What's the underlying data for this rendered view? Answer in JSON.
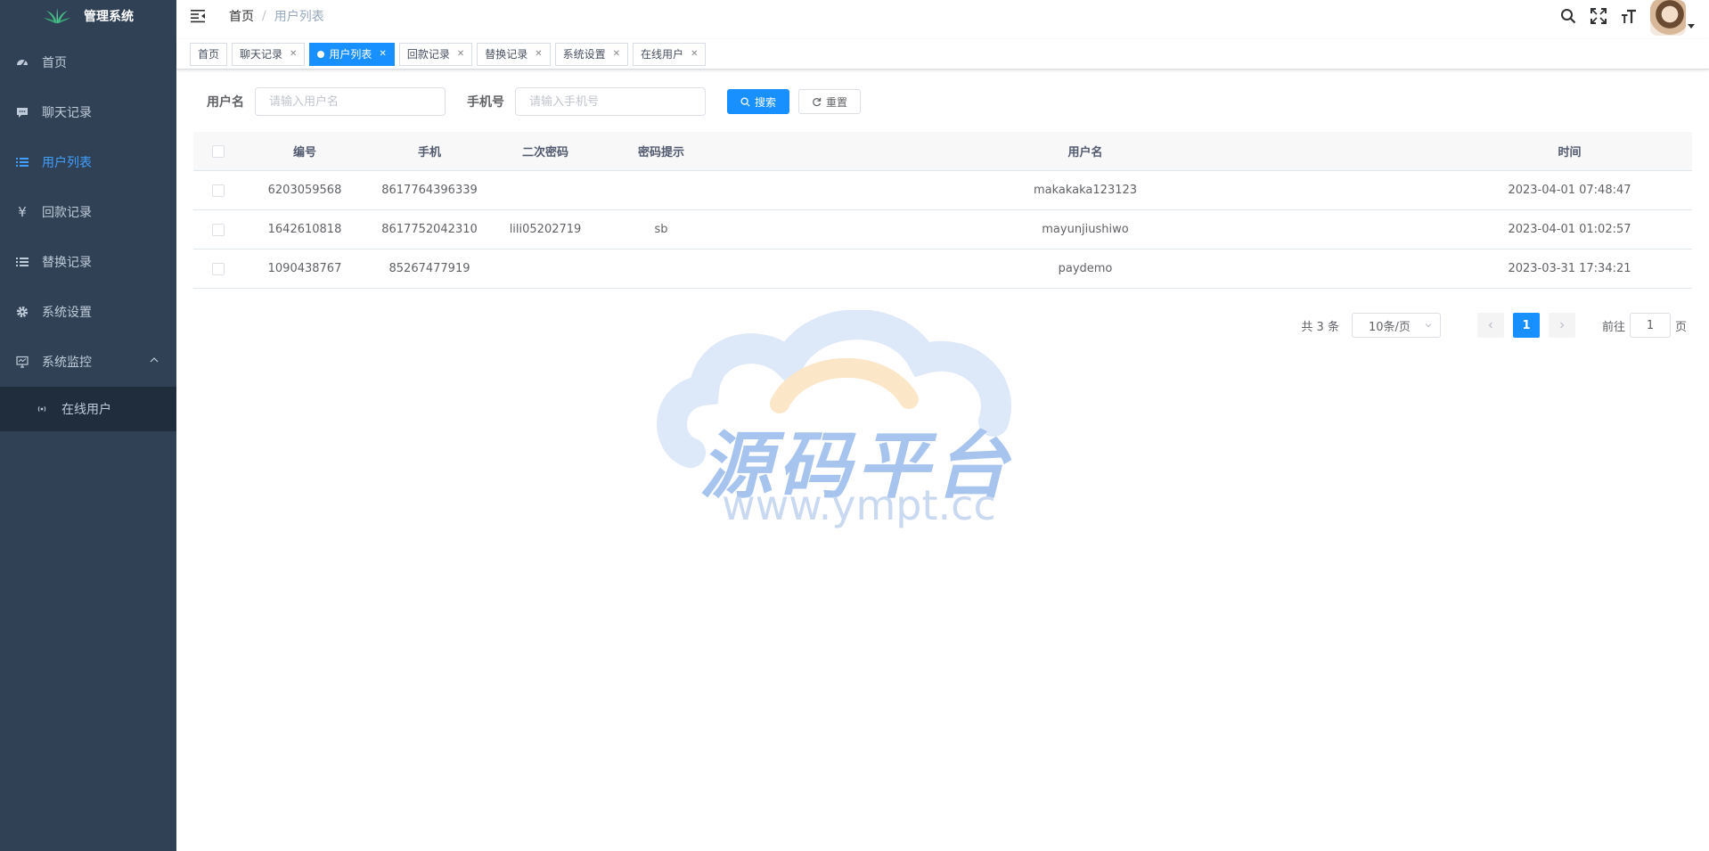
{
  "app": {
    "logo_text": "管理系统"
  },
  "sidebar": {
    "items": [
      {
        "label": "首页",
        "icon": "dashboard-icon"
      },
      {
        "label": "聊天记录",
        "icon": "chat-icon"
      },
      {
        "label": "用户列表",
        "icon": "list-icon",
        "active": true
      },
      {
        "label": "回款记录",
        "icon": "yen-icon"
      },
      {
        "label": "替换记录",
        "icon": "list-icon"
      },
      {
        "label": "系统设置",
        "icon": "gear-icon"
      },
      {
        "label": "系统监控",
        "icon": "monitor-icon",
        "expanded": true
      }
    ],
    "submenu": [
      {
        "label": "在线用户",
        "icon": "online-icon"
      }
    ]
  },
  "breadcrumb": {
    "home": "首页",
    "separator": "/",
    "current": "用户列表"
  },
  "tags": [
    {
      "label": "首页"
    },
    {
      "label": "聊天记录"
    },
    {
      "label": "用户列表",
      "active": true
    },
    {
      "label": "回款记录"
    },
    {
      "label": "替换记录"
    },
    {
      "label": "系统设置"
    },
    {
      "label": "在线用户"
    }
  ],
  "search": {
    "username_label": "用户名",
    "username_placeholder": "请输入用户名",
    "phone_label": "手机号",
    "phone_placeholder": "请输入手机号",
    "search_button": "搜索",
    "reset_button": "重置"
  },
  "table": {
    "columns": [
      "编号",
      "手机",
      "二次密码",
      "密码提示",
      "用户名",
      "时间"
    ],
    "rows": [
      {
        "id": "6203059568",
        "phone": "8617764396339",
        "pwd2": "",
        "hint": "",
        "username": "makakaka123123",
        "time": "2023-04-01 07:48:47"
      },
      {
        "id": "1642610818",
        "phone": "8617752042310",
        "pwd2": "lili05202719",
        "hint": "sb",
        "username": "mayunjiushiwo",
        "time": "2023-04-01 01:02:57"
      },
      {
        "id": "1090438767",
        "phone": "85267477919",
        "pwd2": "",
        "hint": "",
        "username": "paydemo",
        "time": "2023-03-31 17:34:21"
      }
    ]
  },
  "pagination": {
    "total_text": "共 3 条",
    "page_size": "10条/页",
    "current_page": "1",
    "goto_label": "前往",
    "goto_value": "1",
    "page_suffix": "页"
  },
  "watermark": {
    "title": "源码平台",
    "url": "www.ympt.cc"
  },
  "colors": {
    "sidebar_bg": "#304156",
    "sidebar_text": "#bfcbd9",
    "accent": "#1890ff",
    "active_menu": "#409eff"
  }
}
